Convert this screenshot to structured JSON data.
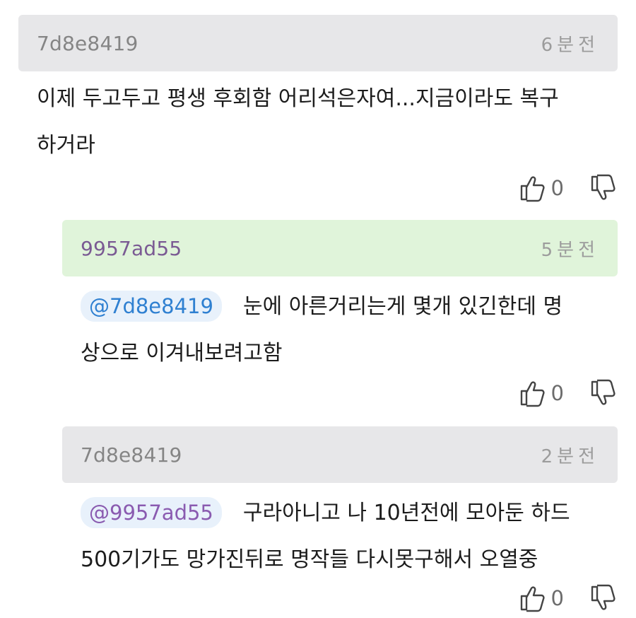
{
  "comments": [
    {
      "author": "7d8e8419",
      "time": "6분전",
      "text_line1": "이제 두고두고 평생 후회함 어리석은자여...지금이라도 복구",
      "text_line2": "하거라",
      "likes": "0"
    },
    {
      "author": "9957ad55",
      "time": "5분전",
      "mention": "@7d8e8419",
      "text_line1": "눈에 아른거리는게 몇개 있긴한데 명",
      "text_line2": "상으로 이겨내보려고함",
      "likes": "0"
    },
    {
      "author": "7d8e8419",
      "time": "2분전",
      "mention": "@9957ad55",
      "text_line1": "구라아니고 나 10년전에 모아둔 하드",
      "text_line2": "500기가도 망가진뒤로 명작들 다시못구해서 오열중",
      "likes": "0"
    }
  ],
  "colors": {
    "header_gray": "#e7e7e9",
    "header_green": "#e0f4da",
    "author_purple": "#7a5a93",
    "mention_blue": "#2f80d1",
    "mention_violet": "#8a5bb0"
  },
  "icons": {
    "like": "thumbs-up-outline",
    "dislike": "thumbs-down-outline"
  }
}
